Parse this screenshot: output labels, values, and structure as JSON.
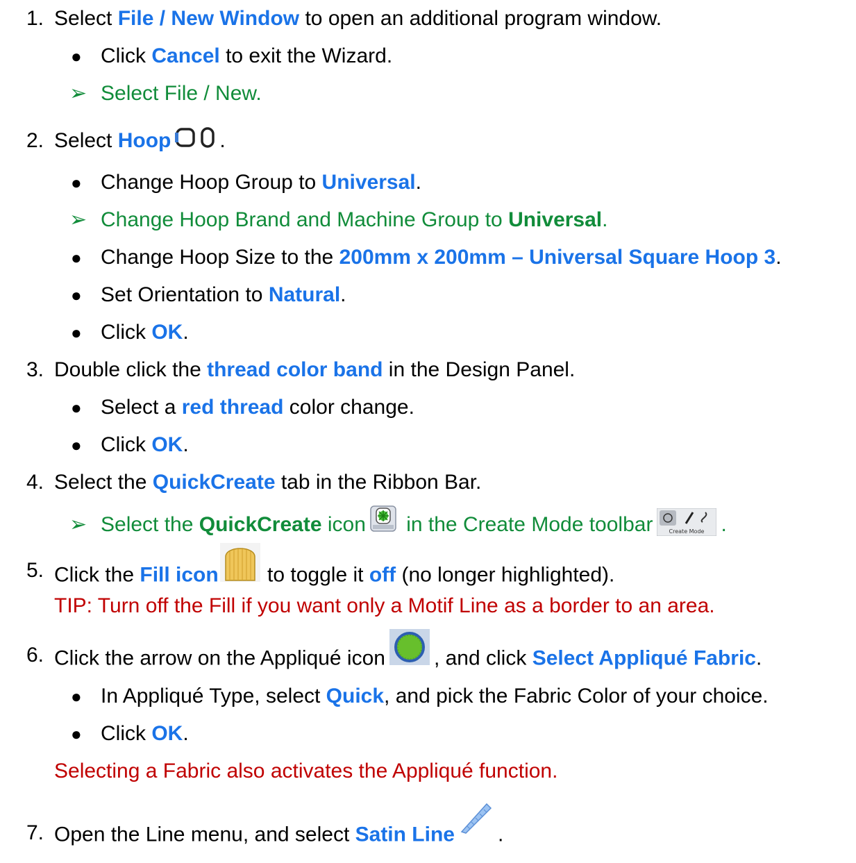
{
  "step1": {
    "num": "1.",
    "pre": "Select ",
    "hl": "File / New Window",
    "post": " to open an additional program window.",
    "b1": {
      "pre": "Click ",
      "hl": "Cancel",
      "post": " to exit the Wizard."
    },
    "a1": "Select File / New."
  },
  "step2": {
    "num": "2.",
    "pre": "Select ",
    "hl": "Hoop",
    "post": ".",
    "b1": {
      "pre": "Change Hoop Group to ",
      "hl": "Universal",
      "post": "."
    },
    "a1": {
      "pre": "Change Hoop Brand and Machine Group to ",
      "hl": "Universal",
      "post": "."
    },
    "b2": {
      "pre": "Change Hoop Size to the ",
      "hl": "200mm x 200mm – Universal Square Hoop 3",
      "post": "."
    },
    "b3": {
      "pre": "Set Orientation to ",
      "hl": "Natural",
      "post": "."
    },
    "b4": {
      "pre": "Click ",
      "hl": "OK",
      "post": "."
    }
  },
  "step3": {
    "num": "3.",
    "pre": "Double click the ",
    "hl": "thread color band",
    "post": " in the Design Panel.",
    "b1": {
      "pre": "Select a ",
      "hl": "red thread",
      "post": " color change."
    },
    "b2": {
      "pre": "Click ",
      "hl": "OK",
      "post": "."
    }
  },
  "step4": {
    "num": "4.",
    "pre": "Select the ",
    "hl": "QuickCreate",
    "post": " tab in the Ribbon Bar.",
    "a1": {
      "pre": "Select the ",
      "hl": "QuickCreate",
      "mid": " icon",
      "mid2": " in the Create Mode toolbar",
      "post": "."
    },
    "toolbar_label": "Create Mode"
  },
  "step5": {
    "num": "5.",
    "pre": "Click the ",
    "hl": "Fill icon",
    "mid": " to toggle it ",
    "hl2": "off",
    "post": " (no longer highlighted).",
    "tip": "TIP:  Turn off the Fill if you want only a Motif Line as a border to an area."
  },
  "step6": {
    "num": "6.",
    "pre": "Click the arrow on the Appliqué icon",
    "mid": ", and click ",
    "hl": "Select Appliqué Fabric",
    "post": ".",
    "b1": {
      "pre": "In Appliqué Type, select ",
      "hl": "Quick",
      "post": ", and pick the Fabric Color of your choice."
    },
    "b2": {
      "pre": "Click ",
      "hl": "OK",
      "post": "."
    },
    "note": "Selecting a Fabric also activates the Appliqué function."
  },
  "step7": {
    "num": "7.",
    "pre": "Open the Line menu, and select ",
    "hl": "Satin Line",
    "post": "."
  },
  "colors": {
    "highlight": "#1a73e8",
    "alt": "#118c3a",
    "tip": "#c00000"
  },
  "icons": [
    "hoop-square-icon",
    "hoop-oval-icon",
    "quickcreate-icon",
    "create-mode-toolbar-icon",
    "fill-icon",
    "applique-icon",
    "satin-line-icon"
  ]
}
